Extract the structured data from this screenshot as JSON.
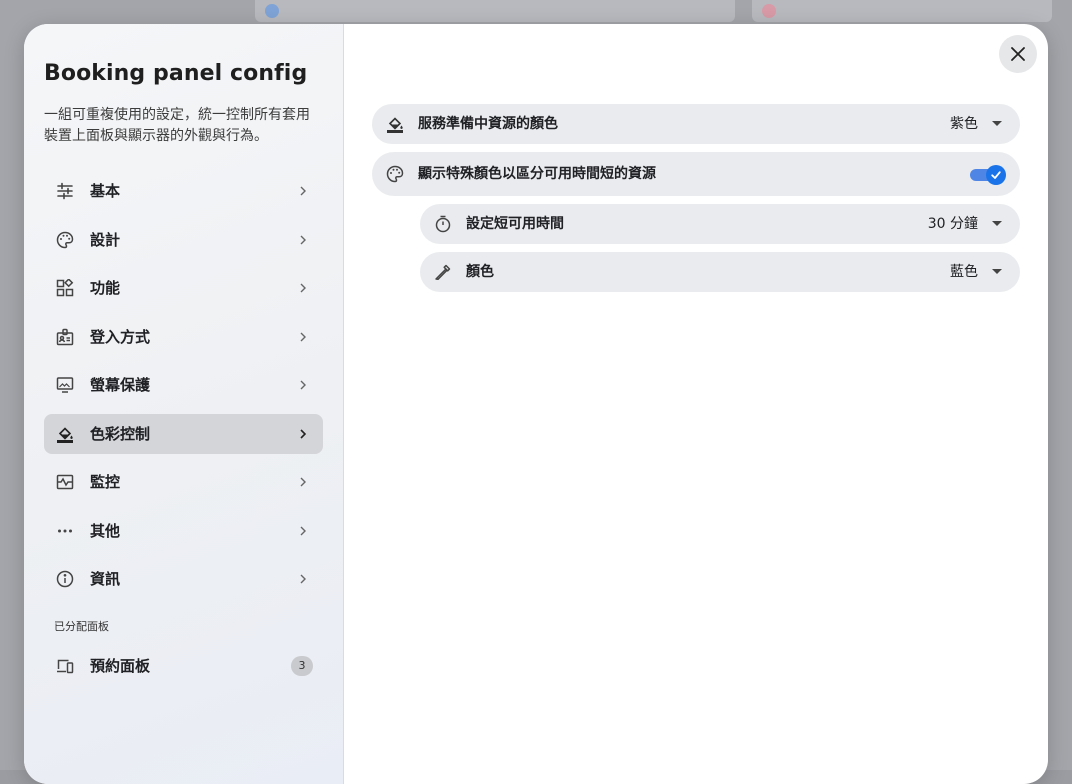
{
  "colors": {
    "accent": "#1a73e8",
    "active_nav_bg": "#d4d5d8",
    "row_bg": "#e9ebee"
  },
  "dialog": {
    "title": "Booking panel config",
    "description": "一組可重複使用的設定，統一控制所有套用裝置上面板與顯示器的外觀與行為。"
  },
  "sidebar": {
    "items": [
      {
        "label": "基本",
        "icon": "tune-icon"
      },
      {
        "label": "設計",
        "icon": "palette-icon"
      },
      {
        "label": "功能",
        "icon": "widgets-icon"
      },
      {
        "label": "登入方式",
        "icon": "badge-icon"
      },
      {
        "label": "螢幕保護",
        "icon": "monitor-icon"
      },
      {
        "label": "色彩控制",
        "icon": "format-color-fill-icon",
        "active": true
      },
      {
        "label": "監控",
        "icon": "monitoring-icon"
      },
      {
        "label": "其他",
        "icon": "more-horiz-icon"
      },
      {
        "label": "資訊",
        "icon": "info-icon"
      }
    ],
    "assigned_section_label": "已分配面板",
    "assigned_item": {
      "label": "預約面板",
      "count": "3",
      "icon": "devices-icon"
    }
  },
  "settings": {
    "prep_color": {
      "label": "服務準備中資源的顏色",
      "value": "紫色",
      "icon": "format-color-fill-icon"
    },
    "special_color": {
      "label": "顯示特殊顏色以區分可用時間短的資源",
      "enabled": true,
      "icon": "palette-icon"
    },
    "short_time": {
      "label": "設定短可用時間",
      "value": "30 分鐘",
      "icon": "timer-icon"
    },
    "color": {
      "label": "顏色",
      "value": "藍色",
      "icon": "colorize-icon"
    }
  }
}
